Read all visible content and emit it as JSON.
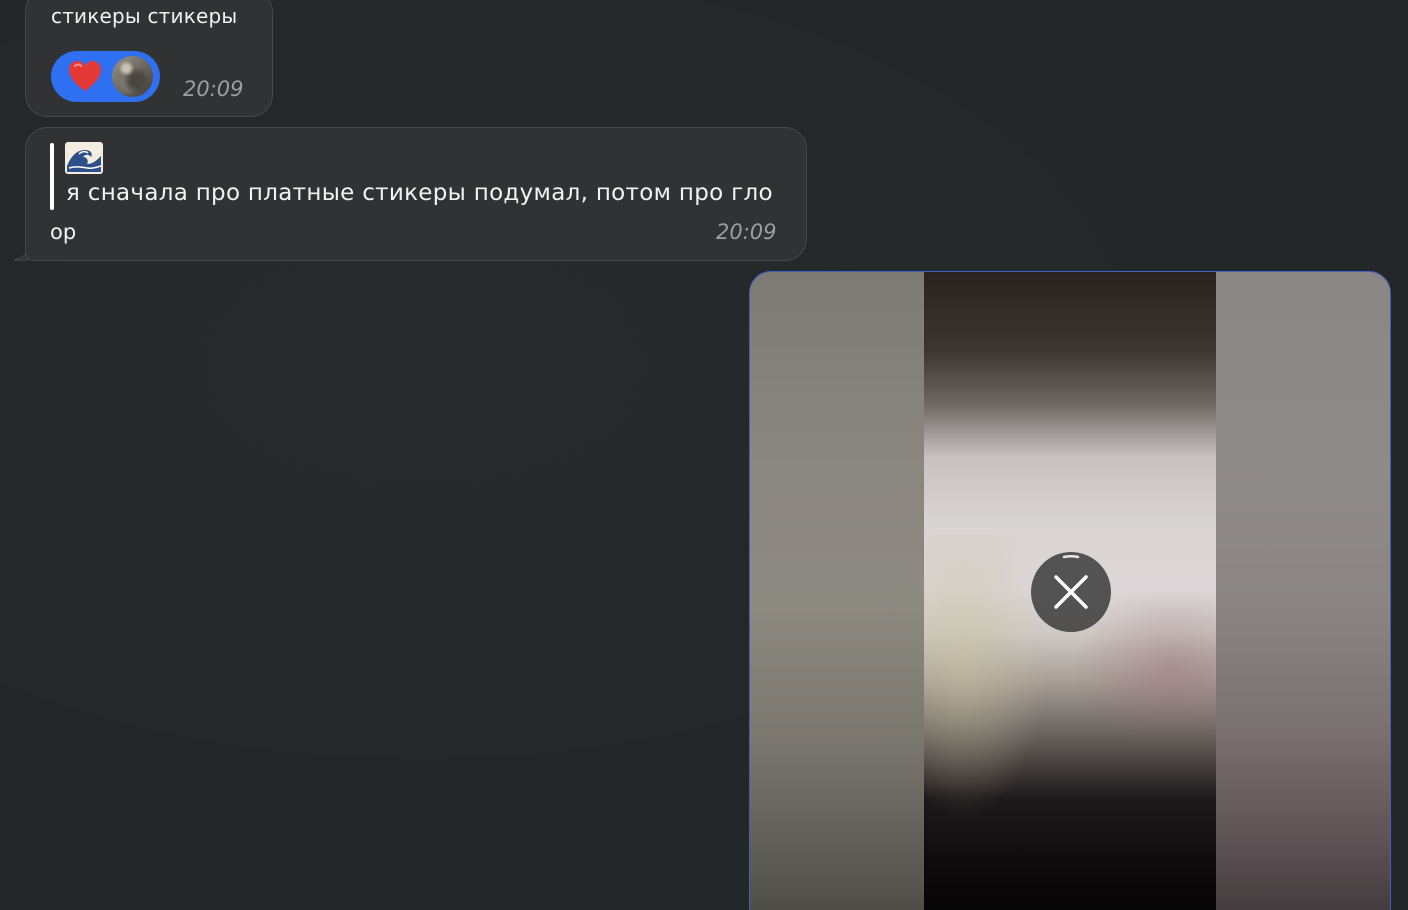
{
  "messages": [
    {
      "text": "стикеры стикеры",
      "time": "20:09",
      "reactions": [
        {
          "icon": "heart-icon",
          "color": "#e53935"
        },
        {
          "icon": "user-avatar"
        }
      ]
    },
    {
      "quote": {
        "icon": "wave-emoji-icon",
        "text": "я сначала про платные стикеры подумал, потом про гло"
      },
      "text": "ор",
      "time": "20:09"
    }
  ],
  "media": {
    "type": "video",
    "state": "loading",
    "action_icon": "close-icon"
  },
  "colors": {
    "background": "#232729",
    "bubble": "#313233",
    "reaction_bg": "#2f6ff2",
    "media_border": "#3e61c7",
    "time": "#9a9ea2"
  }
}
